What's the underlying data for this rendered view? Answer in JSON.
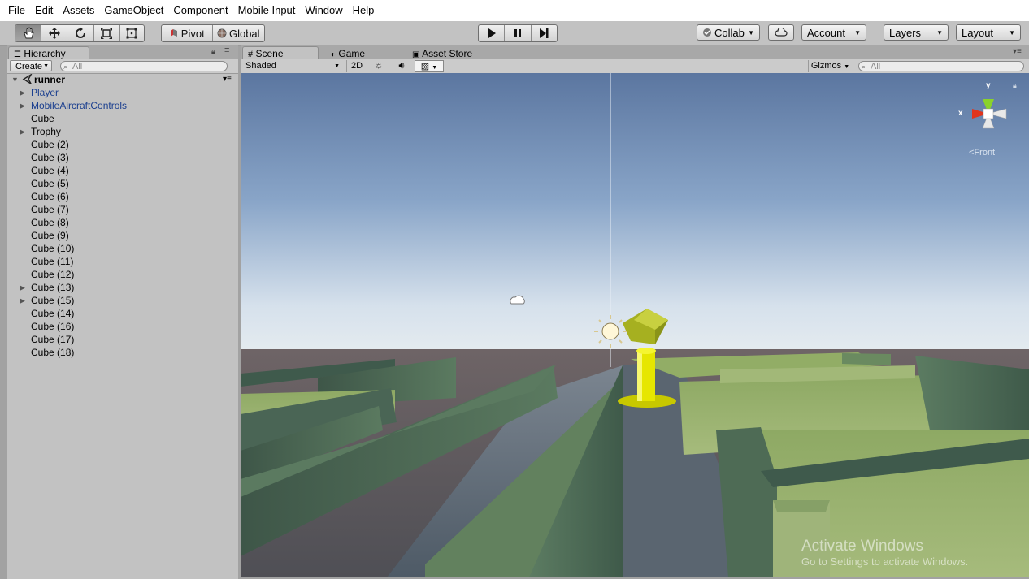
{
  "menubar": {
    "items": [
      "File",
      "Edit",
      "Assets",
      "GameObject",
      "Component",
      "Mobile Input",
      "Window",
      "Help"
    ]
  },
  "toolbar": {
    "tools": [
      "hand-tool",
      "move-tool",
      "rotate-tool",
      "scale-tool",
      "rect-tool"
    ],
    "pivot_label": "Pivot",
    "global_label": "Global",
    "collab_label": "Collab",
    "account_label": "Account",
    "layers_label": "Layers",
    "layout_label": "Layout"
  },
  "hierarchy": {
    "tab_label": "Hierarchy",
    "create_label": "Create",
    "search_placeholder": "All",
    "scene_name": "runner",
    "items": [
      {
        "label": "Player",
        "color": "blue",
        "expandable": true
      },
      {
        "label": "MobileAircraftControls",
        "color": "blue",
        "expandable": true
      },
      {
        "label": "Cube",
        "color": "black",
        "expandable": false
      },
      {
        "label": "Trophy",
        "color": "black",
        "expandable": true
      },
      {
        "label": "Cube (2)",
        "color": "black",
        "expandable": false
      },
      {
        "label": "Cube (3)",
        "color": "black",
        "expandable": false
      },
      {
        "label": "Cube (4)",
        "color": "black",
        "expandable": false
      },
      {
        "label": "Cube (5)",
        "color": "black",
        "expandable": false
      },
      {
        "label": "Cube (6)",
        "color": "black",
        "expandable": false
      },
      {
        "label": "Cube (7)",
        "color": "black",
        "expandable": false
      },
      {
        "label": "Cube (8)",
        "color": "black",
        "expandable": false
      },
      {
        "label": "Cube (9)",
        "color": "black",
        "expandable": false
      },
      {
        "label": "Cube (10)",
        "color": "black",
        "expandable": false
      },
      {
        "label": "Cube (11)",
        "color": "black",
        "expandable": false
      },
      {
        "label": "Cube (12)",
        "color": "black",
        "expandable": false
      },
      {
        "label": "Cube (13)",
        "color": "black",
        "expandable": true
      },
      {
        "label": "Cube (15)",
        "color": "black",
        "expandable": true
      },
      {
        "label": "Cube (14)",
        "color": "black",
        "expandable": false
      },
      {
        "label": "Cube (16)",
        "color": "black",
        "expandable": false
      },
      {
        "label": "Cube (17)",
        "color": "black",
        "expandable": false
      },
      {
        "label": "Cube (18)",
        "color": "black",
        "expandable": false
      }
    ]
  },
  "scene": {
    "tabs": [
      "Scene",
      "Game",
      "Asset Store"
    ],
    "shading_label": "Shaded",
    "mode_2d_label": "2D",
    "gizmos_label": "Gizmos",
    "search_placeholder": "All",
    "gizmo_axis_y": "y",
    "gizmo_axis_x": "x",
    "view_label": "Front",
    "watermark_title": "Activate Windows",
    "watermark_sub": "Go to Settings to activate Windows."
  },
  "colors": {
    "panel_bg": "#c2c2c2",
    "blue_text": "#1b3f8f",
    "sky_top": "#5c77a0",
    "sky_horizon": "#d0dcea",
    "grass": "#7f9a55",
    "wall": "#4d6a5a",
    "trophy": "#e6e600"
  }
}
